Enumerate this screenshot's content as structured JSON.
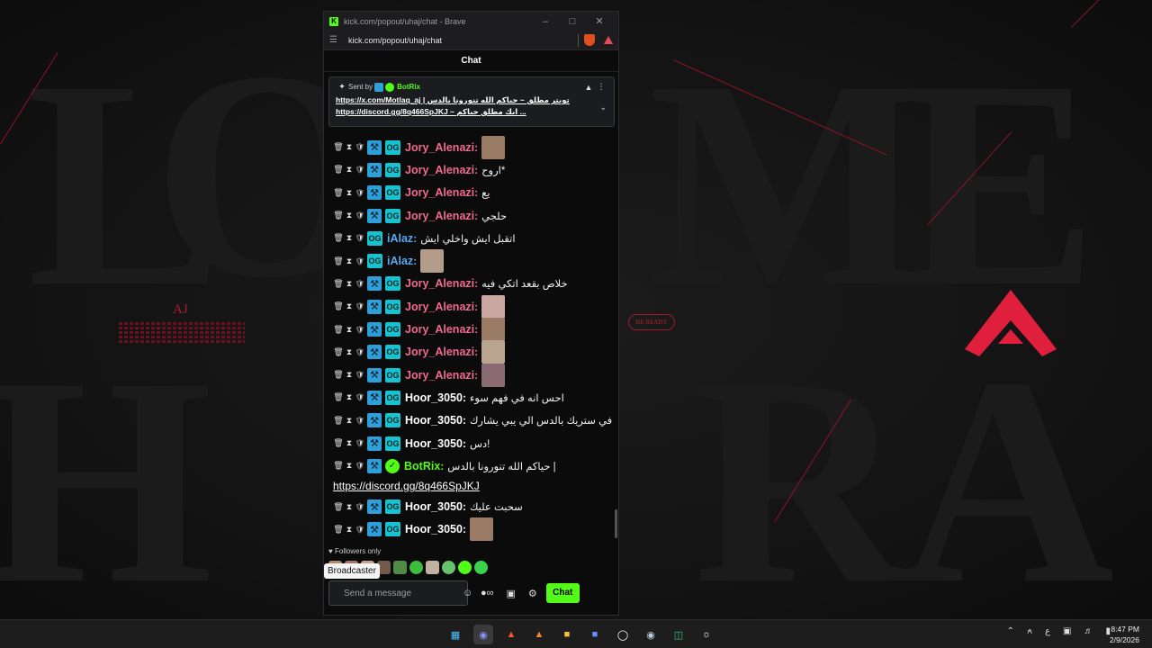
{
  "window": {
    "title": "kick.com/popout/uhaj/chat - Brave",
    "url": "kick.com/popout/uhaj/chat"
  },
  "chat": {
    "header": "Chat",
    "pinned": {
      "sent_by": "Sent by",
      "user": "BotRix",
      "line1": "https://x.com/Motlaq_aj | تويتر مطلق ~ حياكم الله تنورونا بالدس",
      "line2": "https://discord.gg/8q466SpJKJ ~ ايك مطلق حياكم ..."
    },
    "messages": [
      {
        "user": "Jory_Alenazi",
        "color": "#f06a8d",
        "text": "",
        "emote": true,
        "badges": [
          "trash",
          "sand",
          "shield",
          "mod",
          "og"
        ]
      },
      {
        "user": "Jory_Alenazi",
        "color": "#f06a8d",
        "text": "اروح*",
        "badges": [
          "trash",
          "sand",
          "shield",
          "mod",
          "og"
        ]
      },
      {
        "user": "Jory_Alenazi",
        "color": "#f06a8d",
        "text": "يع",
        "badges": [
          "trash",
          "sand",
          "shield",
          "mod",
          "og"
        ]
      },
      {
        "user": "Jory_Alenazi",
        "color": "#f06a8d",
        "text": "حلجي",
        "badges": [
          "trash",
          "sand",
          "shield",
          "mod",
          "og"
        ]
      },
      {
        "user": "iAlaz",
        "color": "#5aa8f0",
        "text": "اتقبل ايش واخلي ايش",
        "badges": [
          "trash",
          "sand",
          "shield",
          "og"
        ]
      },
      {
        "user": "iAlaz",
        "color": "#5aa8f0",
        "text": "",
        "emote": true,
        "badges": [
          "trash",
          "sand",
          "shield",
          "og"
        ]
      },
      {
        "user": "Jory_Alenazi",
        "color": "#f06a8d",
        "text": "خلاص بقعد اتكي فيه",
        "badges": [
          "trash",
          "sand",
          "shield",
          "mod",
          "og"
        ]
      },
      {
        "user": "Jory_Alenazi",
        "color": "#f06a8d",
        "text": "",
        "emote": true,
        "badges": [
          "trash",
          "sand",
          "shield",
          "mod",
          "og"
        ]
      },
      {
        "user": "Jory_Alenazi",
        "color": "#f06a8d",
        "text": "",
        "emote": true,
        "badges": [
          "trash",
          "sand",
          "shield",
          "mod",
          "og"
        ]
      },
      {
        "user": "Jory_Alenazi",
        "color": "#f06a8d",
        "text": "",
        "emote": true,
        "badges": [
          "trash",
          "sand",
          "shield",
          "mod",
          "og"
        ]
      },
      {
        "user": "Jory_Alenazi",
        "color": "#f06a8d",
        "text": "",
        "emote": true,
        "badges": [
          "trash",
          "sand",
          "shield",
          "mod",
          "og"
        ]
      },
      {
        "user": "Hoor_3050",
        "color": "#ffffff",
        "text": "احس انه في فهم سوء",
        "badges": [
          "trash",
          "sand",
          "shield",
          "mod",
          "og"
        ]
      },
      {
        "user": "Hoor_3050",
        "color": "#ffffff",
        "text": "في ستريك بالدس الي يبي يشارك",
        "badges": [
          "trash",
          "sand",
          "shield",
          "mod",
          "og"
        ]
      },
      {
        "user": "Hoor_3050",
        "color": "#ffffff",
        "text": "دس!",
        "badges": [
          "trash",
          "sand",
          "shield",
          "mod",
          "og"
        ]
      },
      {
        "user": "BotRix",
        "color": "#53fc18",
        "text": "حياكم الله تنورونا بالدس |",
        "badges": [
          "trash",
          "sand",
          "shield",
          "mod",
          "verified"
        ]
      },
      {
        "user": "Hoor_3050",
        "color": "#ffffff",
        "text": "سحبت عليك",
        "badges": [
          "trash",
          "sand",
          "shield",
          "mod",
          "og"
        ]
      },
      {
        "user": "Hoor_3050",
        "color": "#ffffff",
        "text": "",
        "emote": true,
        "badges": [
          "trash",
          "sand",
          "shield",
          "mod",
          "og"
        ]
      }
    ],
    "botrix_link": "https://discord.gg/8q466SpJKJ",
    "followers_only": "Followers only",
    "broadcaster_tooltip": "Broadcaster",
    "input_placeholder": "Send a message",
    "send_button": "Chat"
  },
  "wallpaper": {
    "aj_title": "AJ",
    "be_ready": "BE READY"
  },
  "taskbar": {
    "time": "8:47 PM",
    "date": "2/9/2026",
    "lang": "ع"
  },
  "colors": {
    "kick_green": "#53fc18",
    "accent_red": "#b2192f"
  }
}
